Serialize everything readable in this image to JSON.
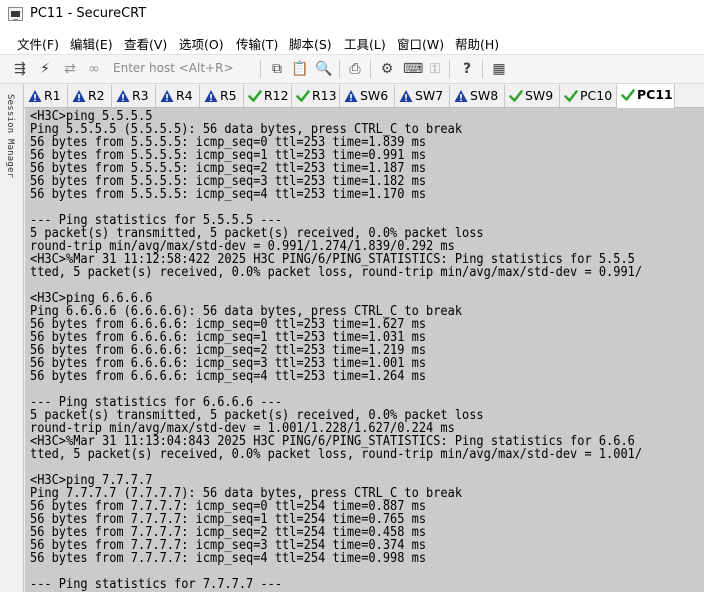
{
  "window": {
    "title": "PC11 - SecureCRT"
  },
  "menu": [
    "文件(F)",
    "编辑(E)",
    "查看(V)",
    "选项(O)",
    "传输(T)",
    "脚本(S)",
    "工具(L)",
    "窗口(W)",
    "帮助(H)"
  ],
  "toolbar": {
    "quick_connect_placeholder": "Enter host <Alt+R>"
  },
  "side_panel": {
    "label": "Session Manager"
  },
  "tabs": [
    {
      "label": "R1",
      "status": "warning"
    },
    {
      "label": "R2",
      "status": "warning"
    },
    {
      "label": "R3",
      "status": "warning"
    },
    {
      "label": "R4",
      "status": "warning"
    },
    {
      "label": "R5",
      "status": "warning"
    },
    {
      "label": "R12",
      "status": "connected"
    },
    {
      "label": "R13",
      "status": "connected"
    },
    {
      "label": "SW6",
      "status": "warning"
    },
    {
      "label": "SW7",
      "status": "warning"
    },
    {
      "label": "SW8",
      "status": "warning"
    },
    {
      "label": "SW9",
      "status": "connected"
    },
    {
      "label": "PC10",
      "status": "connected"
    },
    {
      "label": "PC11",
      "status": "connected",
      "active": true
    }
  ],
  "colors": {
    "warning_icon": "#1f3f9f",
    "connected_icon": "#2fa52f",
    "terminal_bg": "#cbcbcb"
  },
  "terminal": {
    "lines": [
      "<H3C>ping 5.5.5.5",
      "Ping 5.5.5.5 (5.5.5.5): 56 data bytes, press CTRL_C to break",
      "56 bytes from 5.5.5.5: icmp_seq=0 ttl=253 time=1.839 ms",
      "56 bytes from 5.5.5.5: icmp_seq=1 ttl=253 time=0.991 ms",
      "56 bytes from 5.5.5.5: icmp_seq=2 ttl=253 time=1.187 ms",
      "56 bytes from 5.5.5.5: icmp_seq=3 ttl=253 time=1.182 ms",
      "56 bytes from 5.5.5.5: icmp_seq=4 ttl=253 time=1.170 ms",
      "",
      "--- Ping statistics for 5.5.5.5 ---",
      "5 packet(s) transmitted, 5 packet(s) received, 0.0% packet loss",
      "round-trip min/avg/max/std-dev = 0.991/1.274/1.839/0.292 ms",
      "<H3C>%Mar 31 11:12:58:422 2025 H3C PING/6/PING_STATISTICS: Ping statistics for 5.5.5",
      "tted, 5 packet(s) received, 0.0% packet loss, round-trip min/avg/max/std-dev = 0.991/",
      "",
      "<H3C>ping 6.6.6.6",
      "Ping 6.6.6.6 (6.6.6.6): 56 data bytes, press CTRL_C to break",
      "56 bytes from 6.6.6.6: icmp_seq=0 ttl=253 time=1.627 ms",
      "56 bytes from 6.6.6.6: icmp_seq=1 ttl=253 time=1.031 ms",
      "56 bytes from 6.6.6.6: icmp_seq=2 ttl=253 time=1.219 ms",
      "56 bytes from 6.6.6.6: icmp_seq=3 ttl=253 time=1.001 ms",
      "56 bytes from 6.6.6.6: icmp_seq=4 ttl=253 time=1.264 ms",
      "",
      "--- Ping statistics for 6.6.6.6 ---",
      "5 packet(s) transmitted, 5 packet(s) received, 0.0% packet loss",
      "round-trip min/avg/max/std-dev = 1.001/1.228/1.627/0.224 ms",
      "<H3C>%Mar 31 11:13:04:843 2025 H3C PING/6/PING_STATISTICS: Ping statistics for 6.6.6",
      "tted, 5 packet(s) received, 0.0% packet loss, round-trip min/avg/max/std-dev = 1.001/",
      "",
      "<H3C>ping 7.7.7.7",
      "Ping 7.7.7.7 (7.7.7.7): 56 data bytes, press CTRL_C to break",
      "56 bytes from 7.7.7.7: icmp_seq=0 ttl=254 time=0.887 ms",
      "56 bytes from 7.7.7.7: icmp_seq=1 ttl=254 time=0.765 ms",
      "56 bytes from 7.7.7.7: icmp_seq=2 ttl=254 time=0.458 ms",
      "56 bytes from 7.7.7.7: icmp_seq=3 ttl=254 time=0.374 ms",
      "56 bytes from 7.7.7.7: icmp_seq=4 ttl=254 time=0.998 ms",
      "",
      "--- Ping statistics for 7.7.7.7 ---"
    ]
  }
}
